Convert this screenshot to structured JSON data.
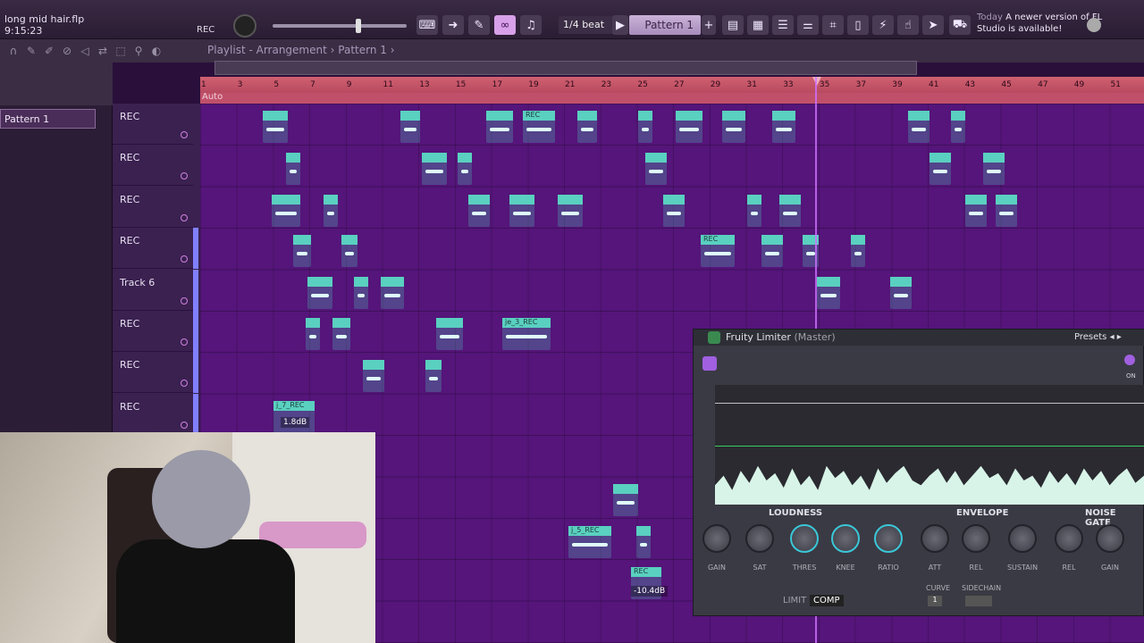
{
  "toolbar": {
    "file_name": "long mid hair.flp",
    "file_time": "9:15:23",
    "rec_label": "REC",
    "snap": "1/4 beat",
    "pattern": "Pattern 1",
    "news_day": "Today",
    "news_text": "A newer version of FL Studio is available!"
  },
  "browser": {
    "pattern_item": "Pattern 1"
  },
  "playlist": {
    "title": "Playlist - Arrangement",
    "pattern": "Pattern 1",
    "auto_label": "Auto",
    "bars": [
      "1",
      "3",
      "5",
      "7",
      "9",
      "11",
      "13",
      "15",
      "17",
      "19",
      "21",
      "23",
      "25",
      "27",
      "29",
      "31",
      "33",
      "35",
      "37",
      "39",
      "41",
      "43",
      "45",
      "47",
      "49",
      "51"
    ],
    "tracks": [
      "REC",
      "REC",
      "REC",
      "REC",
      "Track 6",
      "REC",
      "REC",
      "REC"
    ],
    "clip_labels": {
      "c1": "REC",
      "c2": "je_3_REC",
      "c3": "REC",
      "c4": "j_7_REC",
      "c5": "j_5_REC",
      "c6": "REC"
    },
    "gain_labels": {
      "g1": "1.8dB",
      "g2": "-10.4dB"
    }
  },
  "limiter": {
    "title": "Fruity Limiter",
    "subtitle": "(Master)",
    "presets": "Presets",
    "on_label": "ON",
    "sections": [
      "LOUDNESS",
      "ENVELOPE",
      "NOISE GATE"
    ],
    "knobs": [
      "GAIN",
      "SAT",
      "THRES",
      "KNEE",
      "RATIO",
      "ATT",
      "REL",
      "SUSTAIN",
      "REL",
      "GAIN"
    ],
    "mode_limit": "LIMIT",
    "mode_comp": "COMP",
    "curve_label": "CURVE",
    "curve_value": "1",
    "sidechain_label": "SIDECHAIN"
  }
}
